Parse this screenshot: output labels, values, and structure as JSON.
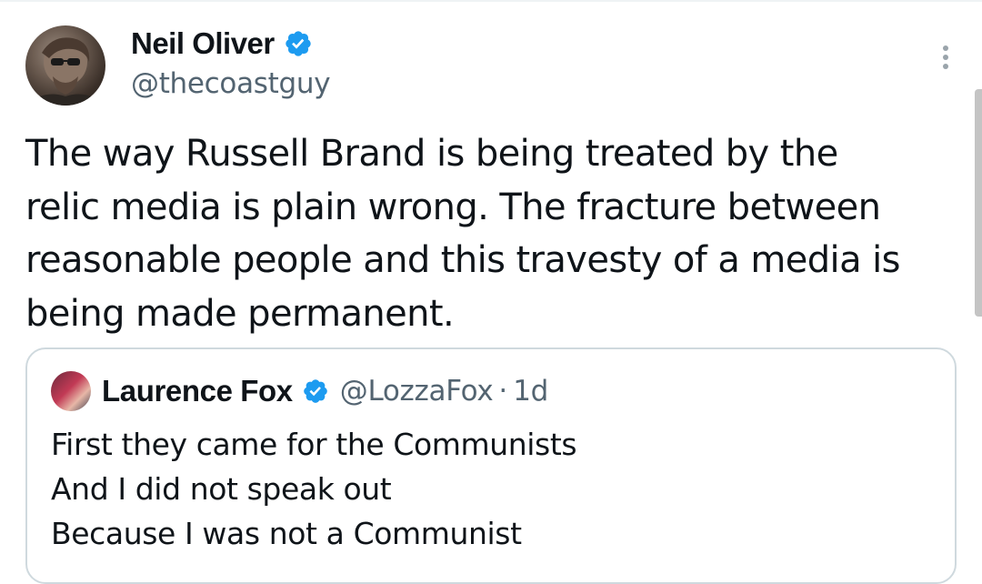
{
  "tweet": {
    "author": {
      "display_name": "Neil Oliver",
      "handle": "@thecoastguy",
      "verified": true
    },
    "text": "The way Russell Brand is being treated by the relic media is plain wrong. The fracture between reasonable people and this travesty of a media is being made permanent.",
    "text_lines": [
      "The way Russell Brand is being treated by the",
      "relic media is plain wrong. The fracture between",
      "reasonable people and this travesty of a media is",
      "being made permanent."
    ],
    "more_menu_icon": "more-vertical-icon"
  },
  "quoted_tweet": {
    "author": {
      "display_name": "Laurence Fox",
      "handle": "@LozzaFox",
      "verified": true
    },
    "separator": "·",
    "time": "1d",
    "lines": [
      "First they came for the Communists",
      "And I did not speak out",
      "Because I was not a Communist"
    ]
  },
  "colors": {
    "text": "#0f1419",
    "secondary_text": "#536471",
    "verified_blue": "#1d9bf0",
    "border": "#cfd9de"
  }
}
